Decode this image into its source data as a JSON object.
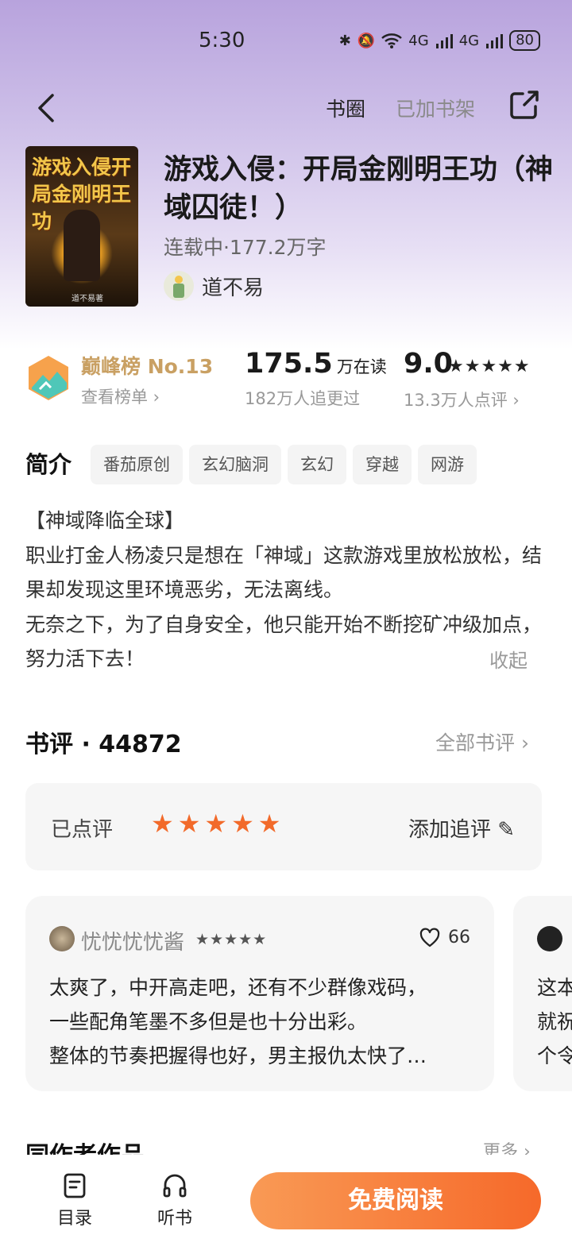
{
  "status_bar": {
    "time": "5:30",
    "signal_text": "4G",
    "battery": "80"
  },
  "top_bar": {
    "circle": "书圈",
    "added": "已加书架"
  },
  "book": {
    "cover_title": "游戏入侵开局金刚明王功",
    "cover_author": "道不易著",
    "title": "游戏入侵：开局金刚明王功（神域囚徒！）",
    "status": "连载中·177.2万字",
    "author": "道不易"
  },
  "stats": {
    "rank_name": "巅峰榜 No.13",
    "rank_link": "查看榜单 ›",
    "reading_num": "175.5",
    "reading_unit": "万在读",
    "follow": "182万人追更过",
    "score": "9.0",
    "score_stars": "★★★★★",
    "score_rating": 4.5,
    "reviewers": "13.3万人点评 ›"
  },
  "intro": {
    "heading": "简介",
    "tags": [
      "番茄原创",
      "玄幻脑洞",
      "玄幻",
      "穿越",
      "网游"
    ],
    "text": "【神域降临全球】\n职业打金人杨凌只是想在「神域」这款游戏里放松放松，结果却发现这里环境恶劣，无法离线。\n无奈之下，为了自身安全，他只能开始不断挖矿冲级加点，努力活下去！",
    "collapse": "收起"
  },
  "reviews": {
    "heading": "书评 · 44872",
    "all": "全部书评 ›",
    "rated_label": "已点评",
    "rated_stars": "★★★★★",
    "add_follow": "添加追评 ✎",
    "cards": [
      {
        "user": "忧忧忧忧酱",
        "stars": "★★★★★",
        "likes": "66",
        "body": "太爽了，中开高走吧，还有不少群像戏码，\n一些配角笔墨不多但是也十分出彩。\n整体的节奏把握得也好，男主报仇太快了…"
      },
      {
        "user": "",
        "stars": "",
        "likes": "",
        "body": "这本\n就祝\n个令"
      }
    ]
  },
  "same_author": {
    "heading": "同作者作品",
    "more": "更多 ›"
  },
  "bottom_bar": {
    "toc": "目录",
    "listen": "听书",
    "read": "免费阅读"
  }
}
